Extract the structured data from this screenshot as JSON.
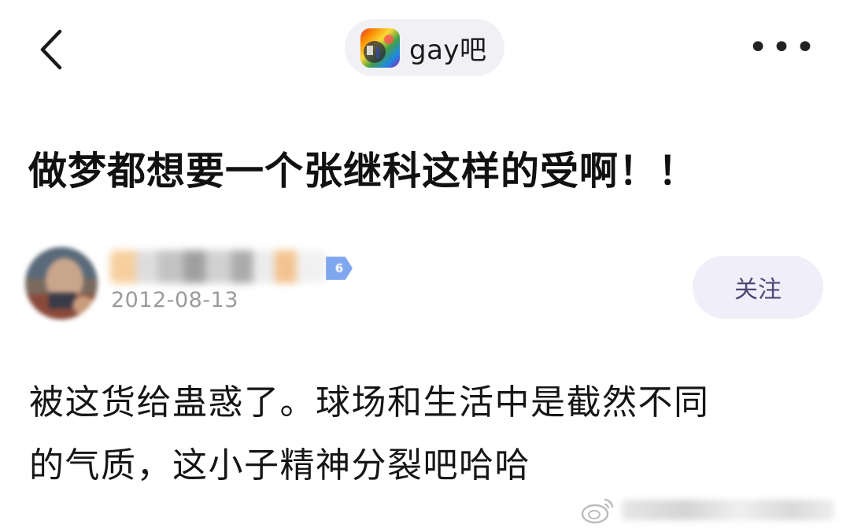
{
  "header": {
    "back_icon": "chevron-left-icon",
    "forum_name": "gay吧",
    "forum_avatar_icon": "rainbow-forum-avatar",
    "more_icon": "more-horizontal-icon",
    "more_label": "•••"
  },
  "post": {
    "title": "做梦都想要一个张继科这样的受啊！！",
    "author": {
      "level": "6",
      "date": "2012-08-13"
    },
    "follow_label": "关注",
    "body_lines": [
      "被这货给蛊惑了。球场和生活中是截然不同",
      "的气质，这小子精神分裂吧哈哈"
    ]
  },
  "colors": {
    "pill_bg": "#f1f1f5",
    "follow_bg": "#f0eef8",
    "follow_text": "#4b4673",
    "date_text": "#9b9b9b",
    "level_badge": "#7fa7ef"
  }
}
